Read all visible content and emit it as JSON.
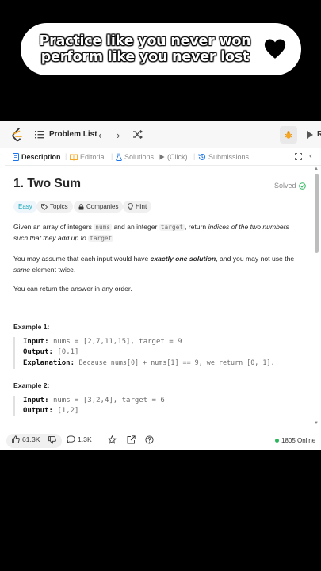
{
  "banner": {
    "line1": "Practice like you never won",
    "line2": "perform like you never lost",
    "icon": "black-heart"
  },
  "topnav": {
    "title": "Problem List",
    "run_label": "R"
  },
  "tabs": [
    {
      "label": "Description",
      "icon": "description-icon",
      "active": true
    },
    {
      "label": "Editorial",
      "icon": "book-icon"
    },
    {
      "label": "Solutions",
      "icon": "flask-icon"
    },
    {
      "label": "(Click)",
      "icon": "pointer-icon"
    },
    {
      "label": "Submissions",
      "icon": "history-icon"
    }
  ],
  "problem": {
    "title": "1. Two Sum",
    "status": "Solved",
    "chips": [
      {
        "label": "Easy"
      },
      {
        "label": "Topics",
        "icon": "tag-icon"
      },
      {
        "label": "Companies",
        "icon": "lock-icon"
      },
      {
        "label": "Hint",
        "icon": "bulb-icon"
      }
    ],
    "desc": {
      "p1_a": "Given an array of integers ",
      "p1_code1": "nums",
      "p1_b": " and an integer ",
      "p1_code2": "target",
      "p1_c": ", return ",
      "p1_italic": "indices of the two numbers such that they add up to",
      "p1_d": " ",
      "p1_code3": "target",
      "p1_e": ".",
      "p2_a": "You may assume that each input would have ",
      "p2_bold": "exactly one solution",
      "p2_b": ", and you may not use the ",
      "p2_italic": "same",
      "p2_c": " element twice.",
      "p3": "You can return the answer in any order."
    },
    "examples": [
      {
        "title": "Example 1:",
        "input_label": "Input:",
        "input": "nums = [2,7,11,15], target = 9",
        "output_label": "Output:",
        "output": "[0,1]",
        "explanation_label": "Explanation:",
        "explanation": "Because nums[0] + nums[1] == 9, we return [0, 1]."
      },
      {
        "title": "Example 2:",
        "input_label": "Input:",
        "input": "nums = [3,2,4], target = 6",
        "output_label": "Output:",
        "output": "[1,2]"
      }
    ]
  },
  "bottombar": {
    "likes": "61.3K",
    "comments": "1.3K",
    "online": "1805 Online"
  },
  "colors": {
    "accent_easy": "#1fa7b8",
    "solved_check": "#2db55d",
    "online_dot": "#2db55d"
  }
}
